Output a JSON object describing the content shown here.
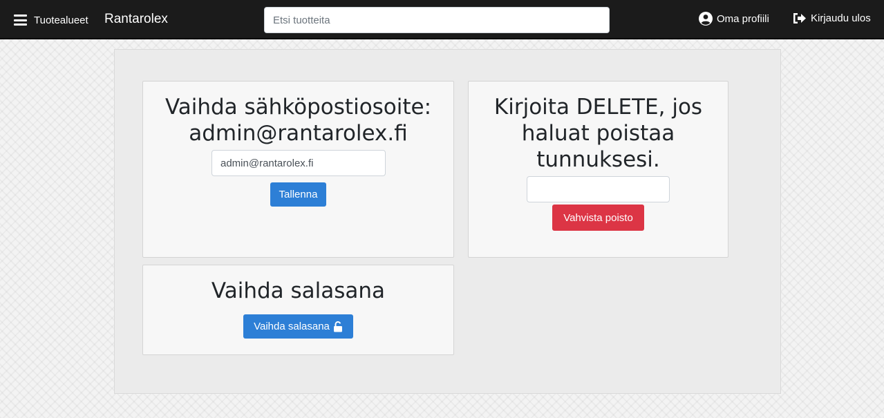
{
  "nav": {
    "menu_label": "Tuotealueet",
    "brand": "Rantarolex",
    "search_placeholder": "Etsi tuotteita",
    "profile_label": "Oma profiili",
    "logout_label": "Kirjaudu ulos",
    "icons": [
      "hamburger-icon",
      "user-circle-icon",
      "sign-out-icon"
    ]
  },
  "email_card": {
    "title_line1": "Vaihda sähköpostiosoite:",
    "title_line2": "admin@rantarolex.fi",
    "email_value": "admin@rantarolex.fi",
    "save_label": "Tallenna"
  },
  "delete_card": {
    "title_line1": "Kirjoita DELETE, jos",
    "title_line2": "haluat poistaa",
    "title_line3": "tunnuksesi.",
    "input_value": "",
    "confirm_label": "Vahvista poisto"
  },
  "password_card": {
    "title": "Vaihda salasana",
    "button_label": "Vaihda salasana",
    "button_icon": "unlock-icon"
  },
  "colors": {
    "navbar": "#1b1b1b",
    "primary": "#2d7fd6",
    "danger": "#dc3545"
  }
}
